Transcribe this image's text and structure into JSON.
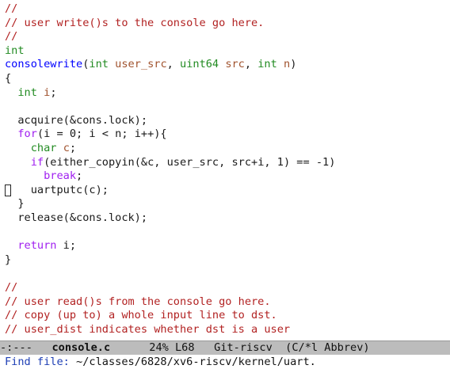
{
  "colors": {
    "comment": "#b22222",
    "keyword": "#a020f0",
    "type": "#228b22",
    "function": "#0000ff",
    "variable": "#a0522d",
    "default": "#1a1a1a",
    "modeline_bg": "#bcbcbc",
    "prompt": "#1e3fb5"
  },
  "editor": {
    "lines": [
      [
        {
          "t": "//",
          "c": "comment"
        }
      ],
      [
        {
          "t": "// user write()s to the console go here.",
          "c": "comment"
        }
      ],
      [
        {
          "t": "//",
          "c": "comment"
        }
      ],
      [
        {
          "t": "int",
          "c": "type"
        }
      ],
      [
        {
          "t": "consolewrite",
          "c": "function"
        },
        {
          "t": "(",
          "c": "default"
        },
        {
          "t": "int",
          "c": "type"
        },
        {
          "t": " ",
          "c": "default"
        },
        {
          "t": "user_src",
          "c": "variable"
        },
        {
          "t": ", ",
          "c": "default"
        },
        {
          "t": "uint64",
          "c": "type"
        },
        {
          "t": " ",
          "c": "default"
        },
        {
          "t": "src",
          "c": "variable"
        },
        {
          "t": ", ",
          "c": "default"
        },
        {
          "t": "int",
          "c": "type"
        },
        {
          "t": " ",
          "c": "default"
        },
        {
          "t": "n",
          "c": "variable"
        },
        {
          "t": ")",
          "c": "default"
        }
      ],
      [
        {
          "t": "{",
          "c": "default"
        }
      ],
      [
        {
          "t": "  ",
          "c": "default"
        },
        {
          "t": "int",
          "c": "type"
        },
        {
          "t": " ",
          "c": "default"
        },
        {
          "t": "i",
          "c": "variable"
        },
        {
          "t": ";",
          "c": "default"
        }
      ],
      [],
      [
        {
          "t": "  acquire(&cons.lock);",
          "c": "default"
        }
      ],
      [
        {
          "t": "  ",
          "c": "default"
        },
        {
          "t": "for",
          "c": "keyword"
        },
        {
          "t": "(i = 0; i < n; i++){",
          "c": "default"
        }
      ],
      [
        {
          "t": "    ",
          "c": "default"
        },
        {
          "t": "char",
          "c": "type"
        },
        {
          "t": " ",
          "c": "default"
        },
        {
          "t": "c",
          "c": "variable"
        },
        {
          "t": ";",
          "c": "default"
        }
      ],
      [
        {
          "t": "    ",
          "c": "default"
        },
        {
          "t": "if",
          "c": "keyword"
        },
        {
          "t": "(either_copyin(&c, user_src, src+i, 1) == -1)",
          "c": "default"
        }
      ],
      [
        {
          "t": "      ",
          "c": "default"
        },
        {
          "t": "break",
          "c": "keyword"
        },
        {
          "t": ";",
          "c": "default"
        }
      ],
      [
        {
          "t": "    uartputc(c);",
          "c": "default"
        }
      ],
      [
        {
          "t": "  }",
          "c": "default"
        }
      ],
      [
        {
          "t": "  release(&cons.lock);",
          "c": "default"
        }
      ],
      [],
      [
        {
          "t": "  ",
          "c": "default"
        },
        {
          "t": "return",
          "c": "keyword"
        },
        {
          "t": " i;",
          "c": "default"
        }
      ],
      [
        {
          "t": "}",
          "c": "default"
        }
      ],
      [],
      [
        {
          "t": "//",
          "c": "comment"
        }
      ],
      [
        {
          "t": "// user read()s from the console go here.",
          "c": "comment"
        }
      ],
      [
        {
          "t": "// copy (up to) a whole input line to dst.",
          "c": "comment"
        }
      ],
      [
        {
          "t": "// user_dist indicates whether dst is a user",
          "c": "comment"
        }
      ]
    ]
  },
  "modeline": {
    "status": "-:---",
    "buffer": "console.c",
    "position": "24% L68",
    "vc": "Git-riscv",
    "modes": "(C/*l Abbrev)"
  },
  "minibuffer": {
    "prompt": "Find file: ",
    "input": "~/classes/6828/xv6-riscv/kernel/uart."
  }
}
